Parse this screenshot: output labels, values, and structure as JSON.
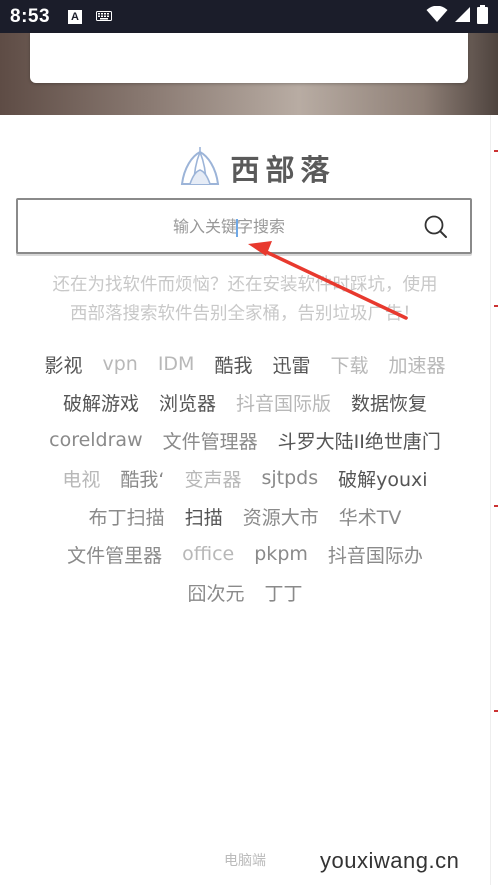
{
  "status_bar": {
    "time": "8:53",
    "notification_icon": "A",
    "icons": [
      "keyboard-icon",
      "wifi-icon",
      "signal-icon",
      "battery-icon"
    ]
  },
  "logo": {
    "text": "西部落"
  },
  "search": {
    "placeholder": "输入关键字搜索",
    "value": ""
  },
  "tagline": {
    "line1": "还在为找软件而烦恼？还在安装软件时踩坑，使用",
    "line2": "西部落搜索软件告别全家桶，告别垃圾广告！"
  },
  "hot_tags": [
    [
      {
        "label": "影视",
        "tone": "dark"
      },
      {
        "label": "vpn",
        "tone": "light"
      },
      {
        "label": "IDM",
        "tone": "light"
      },
      {
        "label": "酷我",
        "tone": "dark"
      },
      {
        "label": "迅雷",
        "tone": "dark"
      },
      {
        "label": "下载",
        "tone": "light"
      },
      {
        "label": "加速器",
        "tone": "light"
      }
    ],
    [
      {
        "label": "破解游戏",
        "tone": "dark"
      },
      {
        "label": "浏览器",
        "tone": "dark"
      },
      {
        "label": "抖音国际版",
        "tone": "light"
      },
      {
        "label": "数据恢复",
        "tone": "dark"
      }
    ],
    [
      {
        "label": "coreldraw",
        "tone": "mid"
      },
      {
        "label": "文件管理器",
        "tone": "mid"
      },
      {
        "label": "斗罗大陆II绝世唐门",
        "tone": "dark"
      }
    ],
    [
      {
        "label": "电视",
        "tone": "light"
      },
      {
        "label": "酷我‘",
        "tone": "mid"
      },
      {
        "label": "变声器",
        "tone": "light"
      },
      {
        "label": "sjtpds",
        "tone": "mid"
      },
      {
        "label": "破解youxi",
        "tone": "dark"
      }
    ],
    [
      {
        "label": "布丁扫描",
        "tone": "mid"
      },
      {
        "label": "扫描",
        "tone": "dark"
      },
      {
        "label": "资源大市",
        "tone": "mid"
      },
      {
        "label": "华术TV",
        "tone": "mid"
      }
    ],
    [
      {
        "label": "文件管里器",
        "tone": "mid"
      },
      {
        "label": "office",
        "tone": "light"
      },
      {
        "label": "pkpm",
        "tone": "mid"
      },
      {
        "label": "抖音国际办",
        "tone": "mid"
      }
    ],
    [
      {
        "label": "囧次元",
        "tone": "mid"
      },
      {
        "label": "丁丁",
        "tone": "mid"
      }
    ]
  ],
  "footer": {
    "desktop_link": "电脑端"
  },
  "watermark": "youxiwang.cn",
  "colors": {
    "status_bar": "#1b1d2a",
    "arrow": "#e8392e",
    "logo_icon": "#9cb4d8"
  }
}
